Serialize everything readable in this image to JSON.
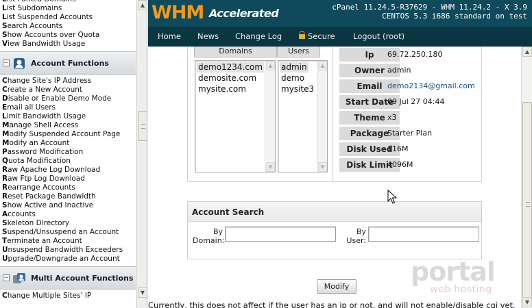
{
  "sidebar": {
    "top_links": [
      {
        "label": "List Parked Domains",
        "key": "L"
      },
      {
        "label": "List Subdomains",
        "key": "L"
      },
      {
        "label": "List Suspended Accounts",
        "key": "L"
      },
      {
        "label": "Search Accounts",
        "key": "S"
      },
      {
        "label": "Show Accounts over Quota",
        "key": "S"
      },
      {
        "label": "View Bandwidth Usage",
        "key": "V"
      }
    ],
    "account_functions": {
      "title": "Account Functions",
      "items": [
        "Change Site's IP Address",
        "Create a New Account",
        "Disable or Enable Demo Mode",
        "Email all Users",
        "Limit Bandwidth Usage",
        "Manage Shell Access",
        "Modify Suspended Account Page",
        "Modify an Account",
        "Password Modification",
        "Quota Modification",
        "Raw Apache Log Download",
        "Raw Ftp Log Download",
        "Rearrange Accounts",
        "Reset Package Bandwidth",
        "Show Active and Inactive",
        "Accounts",
        "Skeleton Directory",
        "Suspend/Unsuspend an Account",
        "Terminate an Account",
        "Unsuspend Bandwidth Exceeders",
        "Upgrade/Downgrade an Account"
      ]
    },
    "multi_account_functions": {
      "title": "Multi Account Functions",
      "items": [
        "Change Multiple Sites' IP"
      ]
    }
  },
  "header": {
    "logo_whm": "WHM",
    "logo_accelerated": "Accelerated",
    "version_line": "cPanel 11.24.5-R37629 - WHM 11.24.2 - X 3.9",
    "os_line": "CENTOS 5.3 i686 standard on test"
  },
  "nav": {
    "items": [
      "Home",
      "News",
      "Change Log",
      "Secure",
      "Logout (root)"
    ]
  },
  "accounts": {
    "domains_header": "Domains",
    "users_header": "Users",
    "domains": [
      "demo1234.com",
      "demosite.com",
      "mysite.com"
    ],
    "users": [
      "admin",
      "demo",
      "mysite3"
    ],
    "selected_domain": "demo1234.com",
    "selected_user": "admin"
  },
  "account_info": {
    "rows": [
      {
        "label": "Ip",
        "value": "69.72.250.180"
      },
      {
        "label": "Owner",
        "value": "admin"
      },
      {
        "label": "Email",
        "value": "demo2134@gmail.com"
      },
      {
        "label": "Start Date",
        "value": "09 Jul 27 04:44"
      },
      {
        "label": "Theme",
        "value": "x3"
      },
      {
        "label": "Package",
        "value": "Starter Plan"
      },
      {
        "label": "Disk Used",
        "value": "116M"
      },
      {
        "label": "Disk Limit",
        "value": "4096M"
      }
    ]
  },
  "account_search": {
    "title": "Account Search",
    "by_domain_label_1": "By",
    "by_domain_label_2": "Domain:",
    "by_user_label_1": "By",
    "by_user_label_2": "User:",
    "domain_value": "",
    "user_value": ""
  },
  "actions": {
    "modify_label": "Modify"
  },
  "footer_note": "Currently, this does not affect if the user has an ip or not, and will not enable/disable cgi yet.",
  "watermark": {
    "line1": "portal",
    "line2": "web hosting"
  },
  "colors": {
    "header_bg": "#0f4a5c",
    "nav_bg": "#0a3644",
    "logo_orange": "#f29a1a",
    "label_bg": "#dadada"
  }
}
